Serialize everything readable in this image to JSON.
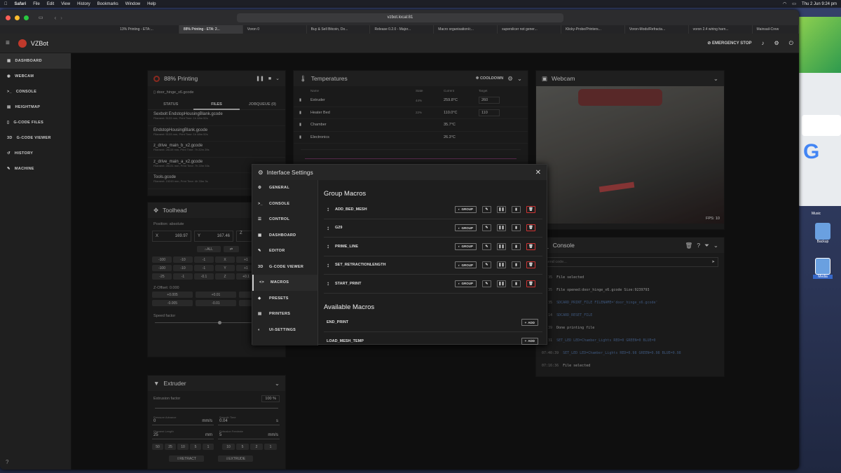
{
  "menubar": {
    "items": [
      "Safari",
      "File",
      "Edit",
      "View",
      "History",
      "Bookmarks",
      "Window",
      "Help"
    ],
    "clock": "Thu 2 Jun  9:24 pm"
  },
  "browser": {
    "url": "vzbot.local:81",
    "tabs": [
      "13% Printing - ETA:...",
      "88% Printing - ETA: 2...",
      "Voron 0",
      "Buy & Sell Bitcoin, Do...",
      "Release 0.2.0 - Major...",
      "Macro organisation/c...",
      "superslicer not gener...",
      "Klicky-Probe/Printers...",
      "Voron-Mods/Refracta...",
      "voron 2.4 wiring harn...",
      "Mainsail-Crew"
    ]
  },
  "app": {
    "name": "VZBot",
    "emergency": "EMERGENCY STOP"
  },
  "sidebar": [
    "DASHBOARD",
    "WEBCAM",
    "CONSOLE",
    "HEIGHTMAP",
    "G-CODE FILES",
    "G-CODE VIEWER",
    "HISTORY",
    "MACHINE"
  ],
  "status": {
    "title": "88% Printing",
    "file": "door_hinge_x6.gcode",
    "tabs": [
      "STATUS",
      "FILES",
      "JOBQUEUE (0)"
    ],
    "files": [
      {
        "name": "Sexbolt EndstopHousingBlank.gcode",
        "meta": "Filament: 5133 mm, Print Time: 1h 48m 52s"
      },
      {
        "name": "EndstopHousingBlank.gcode",
        "meta": "Filament: 5133 mm, Print Time: 1h 48m 52s"
      },
      {
        "name": "z_drive_main_b_x2.gcode",
        "meta": "Filament: 28119 mm, Print Time: 7h 22m 29s"
      },
      {
        "name": "z_drive_main_a_x2.gcode",
        "meta": "Filament: 28131 mm, Print Time: 7h 22m 53s"
      },
      {
        "name": "Tools.gcode",
        "meta": "Filament: 15245 mm, Print Time: 4h 33m 3s"
      }
    ]
  },
  "temps": {
    "title": "Temperatures",
    "cooldown": "COOLDOWN",
    "cols": [
      "Name",
      "State",
      "Current",
      "Target"
    ],
    "rows": [
      {
        "name": "Extruder",
        "state": "44%",
        "current": "259.8°C",
        "target": "260"
      },
      {
        "name": "Heater Bed",
        "state": "22%",
        "current": "110.0°C",
        "target": "110"
      },
      {
        "name": "Chamber",
        "state": "",
        "current": "35.7°C",
        "target": ""
      },
      {
        "name": "Electronics",
        "state": "",
        "current": "26.3°C",
        "target": ""
      }
    ]
  },
  "webcam": {
    "title": "Webcam",
    "fps": "FPS: 10"
  },
  "toolhead": {
    "title": "Toolhead",
    "position": "Position: absolute",
    "x": "169.97",
    "y": "167.46",
    "all": "ALL",
    "zoffset": "Z-Offset: 0.000",
    "speed": "Speed factor",
    "r1": [
      "-100",
      "-10",
      "-1",
      "X",
      "+1",
      "+"
    ],
    "r2": [
      "-100",
      "-10",
      "-1",
      "Y",
      "+1",
      "+"
    ],
    "r3": [
      "-25",
      "-1",
      "-0.1",
      "Z",
      "+0.1"
    ],
    "zp": [
      "+0.005",
      "+0.01",
      "+0.025"
    ],
    "zm": [
      "-0.005",
      "-0.01",
      "-0.025"
    ]
  },
  "extruder": {
    "title": "Extruder",
    "factor": "Extrusion factor",
    "factor_val": "100",
    "pa_label": "Pressure Advance",
    "pa": "0",
    "st_label": "Smooth Time",
    "st": "0.04",
    "fl_label": "Filament Length",
    "fl": "25",
    "es_label": "Extrusion Feedrate",
    "es": "5",
    "lens": [
      "50",
      "25",
      "10",
      "5",
      "1"
    ],
    "speeds": [
      "10",
      "5",
      "2",
      "1"
    ],
    "retract": "RETRACT",
    "extrude": "EXTRUDE"
  },
  "console": {
    "title": "Console",
    "placeholder": "Send code...",
    "lines": [
      {
        "t": "05:35",
        "m": "File selected",
        "b": false
      },
      {
        "t": "05:35",
        "m": "File opened:door_hinge_x6.gcode Size:9239793",
        "b": false
      },
      {
        "t": "05:35",
        "m": "SDCARD_PRINT_FILE FILENAME='door_hinge_x6.gcode'",
        "b": true
      },
      {
        "t": "04:14",
        "m": "SDCARD_RESET_FILE",
        "b": true
      },
      {
        "t": "46:39",
        "m": "Done printing file",
        "b": false
      },
      {
        "t": "45:31",
        "m": "SET_LED LED=Chamber_Lights RED=0 GREEN=0 BLUE=0",
        "b": true
      },
      {
        "t": "07:40:39",
        "m": "SET_LED LED=Chamber_Lights RED=0.98 GREEN=0.98 BLUE=0.98",
        "b": true
      },
      {
        "t": "07:16:36",
        "m": "File selected",
        "b": false
      }
    ]
  },
  "dialog": {
    "title": "Interface Settings",
    "nav": [
      "GENERAL",
      "CONSOLE",
      "CONTROL",
      "DASHBOARD",
      "EDITOR",
      "G-CODE VIEWER",
      "MACROS",
      "PRESETS",
      "PRINTERS",
      "UI-SETTINGS"
    ],
    "group_title": "Group Macros",
    "group_btn": "GROUP",
    "macros": [
      "ADD_BED_MESH",
      "G29",
      "PRIME_LINE",
      "SET_RETRACTIONLENGTH",
      "START_PRINT"
    ],
    "avail_title": "Available Macros",
    "add_btn": "ADD",
    "avail": [
      "END_PRINT",
      "LOAD_MESH_TEMP"
    ]
  },
  "dock": {
    "music": "Music",
    "backup": "Backup",
    "media": "Media"
  }
}
